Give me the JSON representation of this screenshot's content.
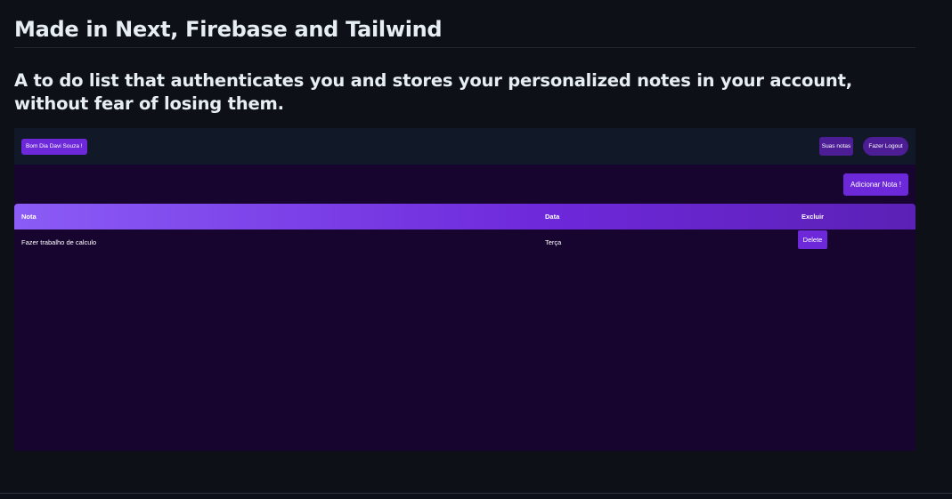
{
  "readme": {
    "heading": "Made in Next, Firebase and Tailwind",
    "description": "A to do list that authenticates you and stores your personalized notes in your account, without fear of losing them."
  },
  "app": {
    "greeting_button": "Bom Dia Davi Souza !",
    "nav": {
      "notes_button": "Suas notas",
      "logout_button": "Fazer Logout"
    },
    "add_note_button": "Adicionar Nota !",
    "table": {
      "headers": [
        "Nota",
        "Data",
        "Excluir"
      ],
      "rows": [
        {
          "note": "Fazer trabalho de calculo",
          "date": "Terça",
          "delete_label": "Delete"
        }
      ]
    },
    "colors": {
      "accent": "#6d28d9",
      "background": "#170530",
      "nav_background": "#111827"
    }
  },
  "colors": {
    "page_background": "#0d1117",
    "text": "#e6edf3"
  }
}
